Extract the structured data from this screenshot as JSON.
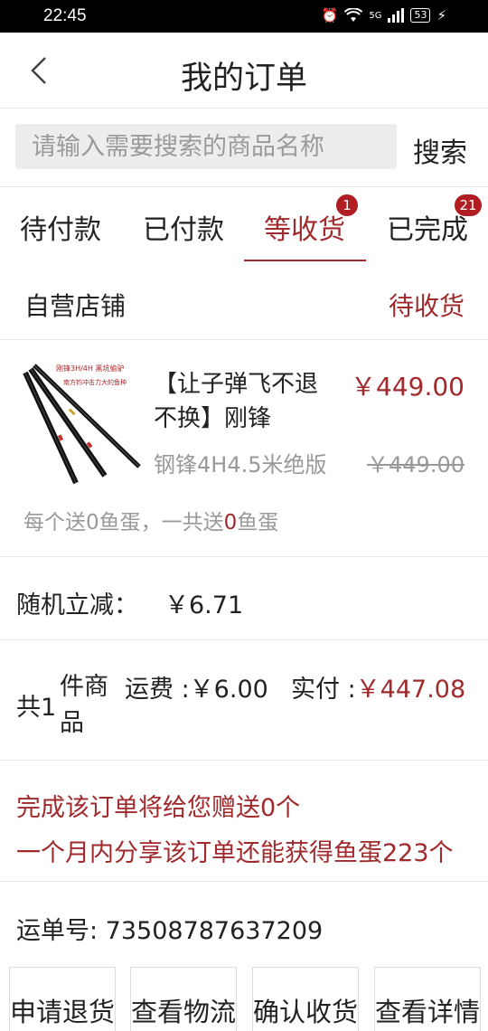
{
  "status_bar": {
    "time": "22:45",
    "network": "5G",
    "battery": "53"
  },
  "header": {
    "title": "我的订单"
  },
  "search": {
    "placeholder": "请输入需要搜索的商品名称",
    "button_label": "搜索"
  },
  "tabs": [
    {
      "label": "待付款",
      "badge": ""
    },
    {
      "label": "已付款",
      "badge": ""
    },
    {
      "label": "等收货",
      "badge": "1",
      "active": true
    },
    {
      "label": "已完成",
      "badge": "21"
    }
  ],
  "shop": {
    "name": "自营店铺",
    "status": "待收货"
  },
  "product": {
    "image_caption_1": "刚锋3H/4H 黑坑偷驴",
    "image_caption_2": "南方钓冲击力大的鱼种",
    "title": "【让子弹飞不退不换】刚锋",
    "price": "￥449.00",
    "spec": "钢锋4H4.5米绝版",
    "original_price": "￥449.00",
    "gift_prefix": "每个送0鱼蛋，一共送",
    "gift_count": "0",
    "gift_suffix": "鱼蛋"
  },
  "discount": {
    "label": "随机立减：",
    "value": "￥6.71"
  },
  "summary": {
    "count_prefix": "共1",
    "count_unit": "件商品",
    "shipping": "运费 :￥6.00",
    "paid_label": "实付 :",
    "paid_value": "￥447.08"
  },
  "reward": {
    "line1": "完成该订单将给您赠送0个",
    "line2": "一个月内分享该订单还能获得鱼蛋223个"
  },
  "tracking": {
    "text": "运单号: 73508787637209"
  },
  "actions": [
    {
      "label": "申请退货"
    },
    {
      "label": "查看物流"
    },
    {
      "label": "确认收货"
    },
    {
      "label": "查看详情"
    }
  ],
  "colors": {
    "accent": "#a02a2c",
    "badge": "#b01e23",
    "muted": "#999999"
  }
}
